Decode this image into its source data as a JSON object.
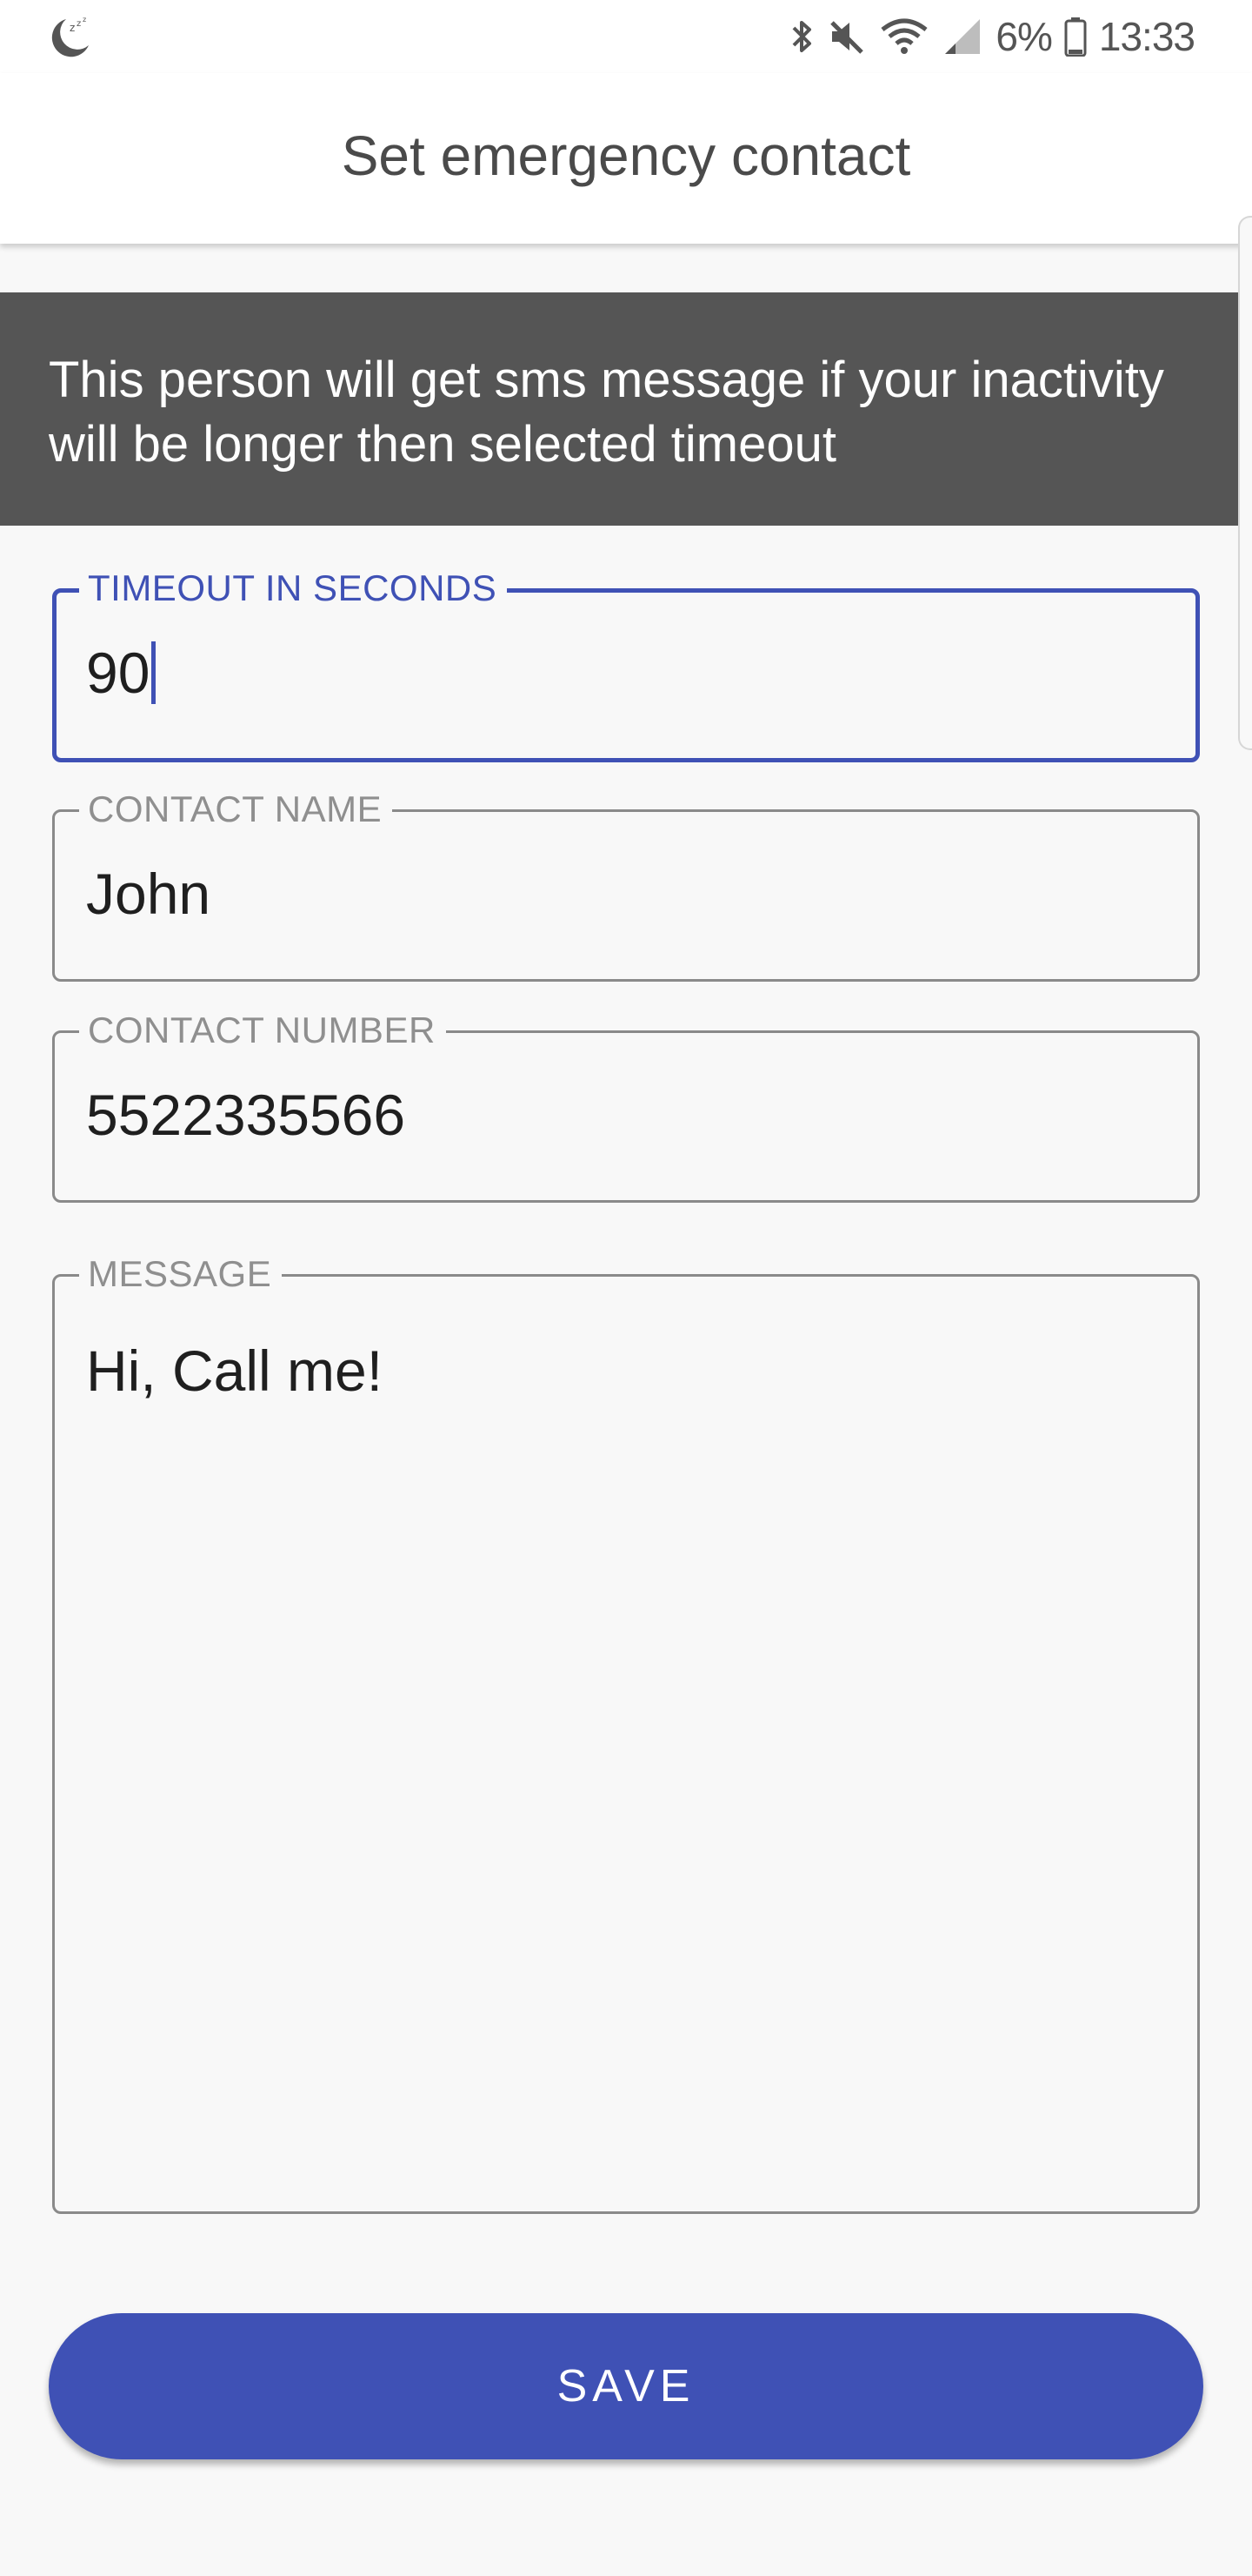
{
  "status_bar": {
    "left_icon": "sleep-moon-icon",
    "icons": [
      "bluetooth-icon",
      "mute-icon",
      "wifi-icon",
      "signal-icon",
      "battery-icon"
    ],
    "battery_text": "6%",
    "time": "13:33"
  },
  "app_bar": {
    "title": "Set emergency contact"
  },
  "info_banner": {
    "text": "This person will get sms message if your inactivity will be longer then selected timeout"
  },
  "form": {
    "timeout": {
      "label": "TIMEOUT IN SECONDS",
      "value": "90"
    },
    "contact_name": {
      "label": "CONTACT NAME",
      "value": "John"
    },
    "contact_number": {
      "label": "CONTACT NUMBER",
      "value": "5522335566"
    },
    "message": {
      "label": "MESSAGE",
      "value": "Hi, Call me!"
    }
  },
  "save_button": {
    "label": "SAVE"
  },
  "colors": {
    "accent": "#3f51b5",
    "banner": "#555555",
    "background": "#f8f8f8"
  }
}
